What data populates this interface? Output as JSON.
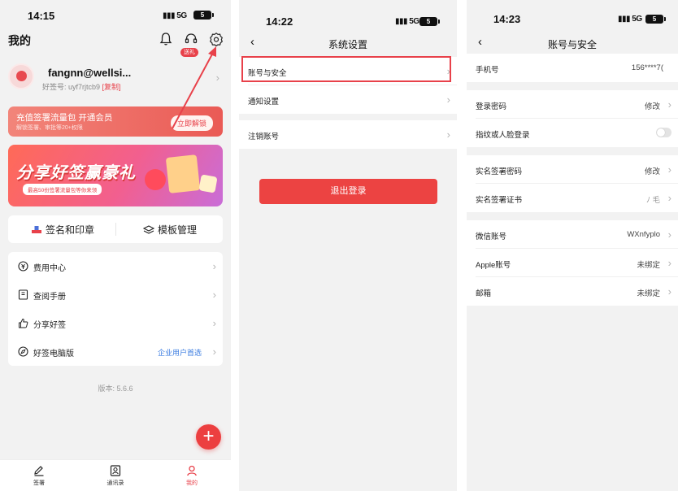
{
  "screen1": {
    "status": {
      "time": "14:15",
      "network": "5G",
      "battery": "5"
    },
    "title": "我的",
    "gift_badge": "送礼",
    "profile": {
      "name": "fangnn@wellsi...",
      "id_label": "好签号: uyf7rjtcb9",
      "copy_label": "[复制]"
    },
    "vip": {
      "title": "充值签署流量包 开通会员",
      "subtitle": "解锁签署、审批等20+权限",
      "button": "立即解锁"
    },
    "banner": {
      "title": "分享好签赢豪礼",
      "subtitle": "最高50份签署流量包等你来领"
    },
    "tools": [
      {
        "label": "签名和印章"
      },
      {
        "label": "模板管理"
      }
    ],
    "menu": [
      {
        "label": "费用中心",
        "right": ""
      },
      {
        "label": "查阅手册",
        "right": ""
      },
      {
        "label": "分享好签",
        "right": ""
      },
      {
        "label": "好签电脑版",
        "right": "企业用户首选"
      }
    ],
    "version": "版本: 5.6.6",
    "fab": "+",
    "tabs": [
      {
        "label": "签署"
      },
      {
        "label": "通讯录"
      },
      {
        "label": "我的"
      }
    ],
    "colors": {
      "accent": "#e8414a",
      "link": "#3a7be0"
    }
  },
  "screen2": {
    "status": {
      "time": "14:22",
      "network": "5G",
      "battery": "5"
    },
    "title": "系统设置",
    "rows": [
      {
        "label": "账号与安全"
      },
      {
        "label": "通知设置"
      },
      {
        "label": "注销账号"
      }
    ],
    "logout": "退出登录"
  },
  "screen3": {
    "status": {
      "time": "14:23",
      "network": "5G",
      "battery": "5"
    },
    "title": "账号与安全",
    "phone": {
      "label": "手机号",
      "value": "156****7("
    },
    "login_password": {
      "label": "登录密码",
      "value": "修改"
    },
    "biometric": {
      "label": "指纹或人脸登录",
      "enabled": false
    },
    "sign_password": {
      "label": "实名签署密码",
      "value": "修改"
    },
    "sign_cert": {
      "label": "实名签署证书",
      "value": "ﾉ 毛"
    },
    "wechat": {
      "label": "微信账号",
      "value": "WXnfyplo"
    },
    "apple": {
      "label": "Apple账号",
      "value": "未绑定"
    },
    "email": {
      "label": "邮箱",
      "value": "未绑定"
    }
  }
}
